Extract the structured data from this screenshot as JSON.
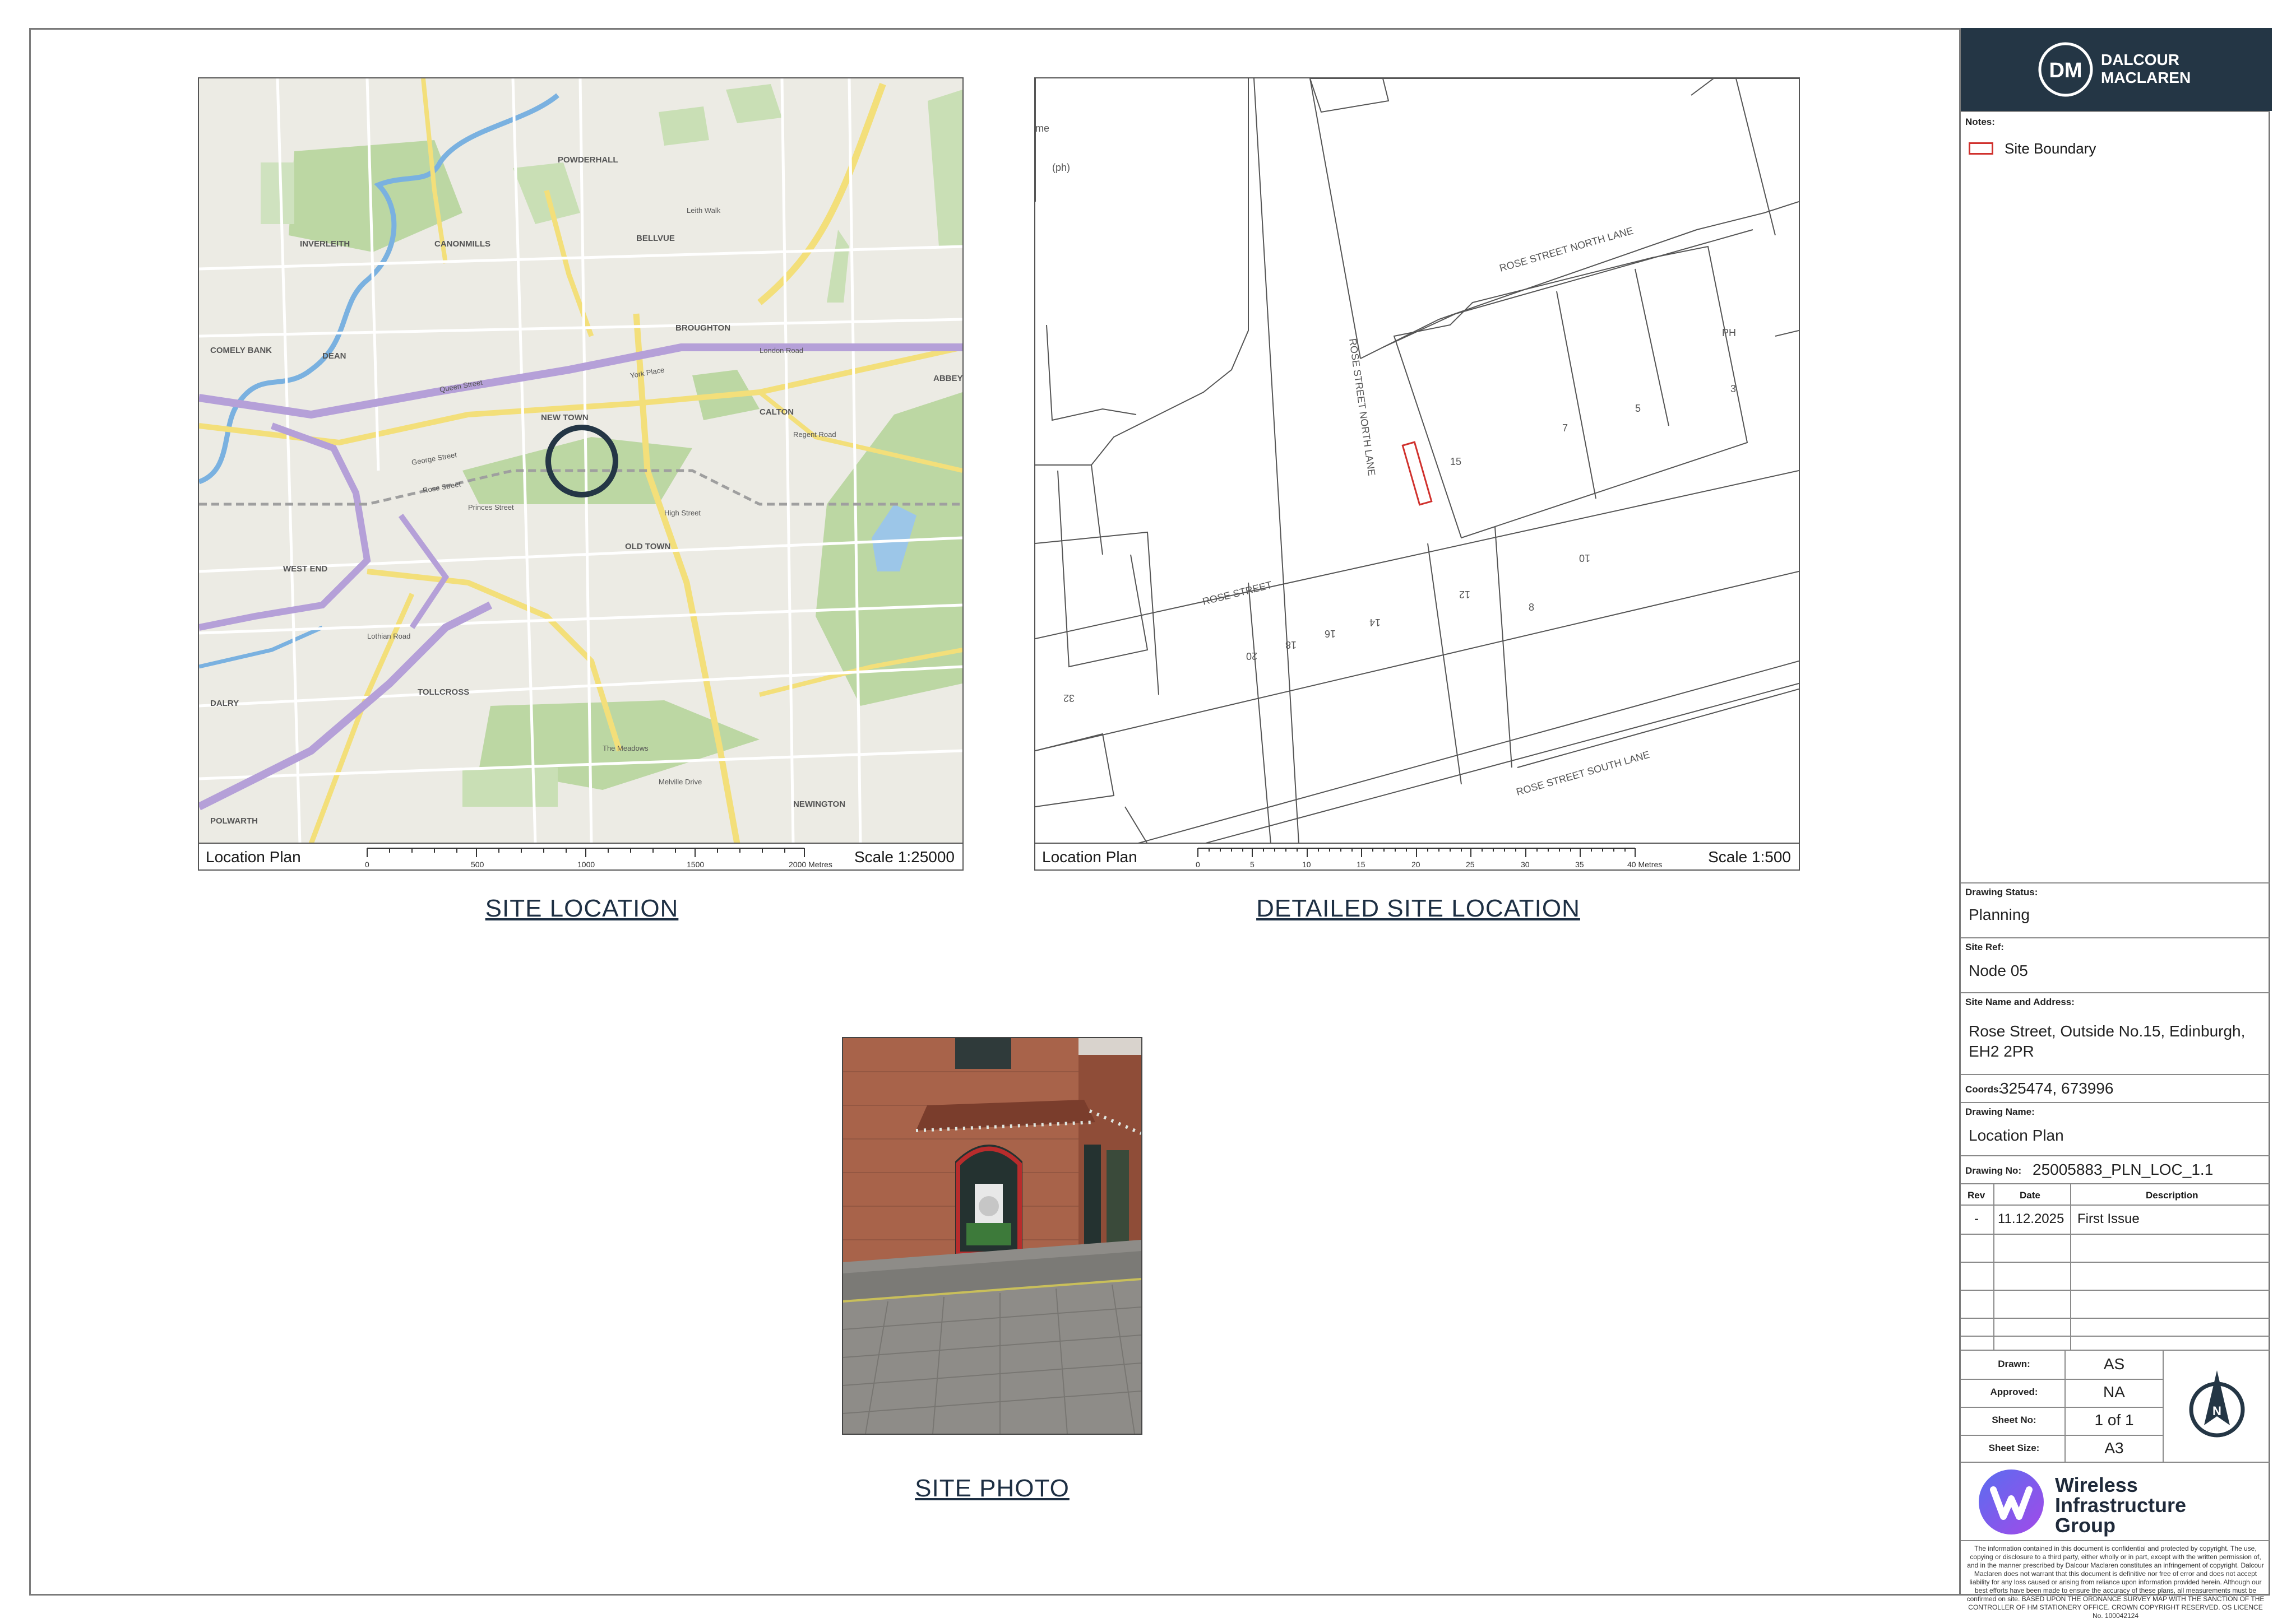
{
  "captions": {
    "site_location": "SITE LOCATION",
    "detailed_site_location": "DETAILED SITE LOCATION",
    "site_photo": "SITE PHOTO"
  },
  "map1": {
    "label": "Location Plan",
    "scale": "Scale 1:25000",
    "ticks": [
      "0",
      "500",
      "1000",
      "1500",
      "2000 Metres"
    ],
    "places": [
      "POWDERHALL",
      "INVERLEITH",
      "CANONMILLS",
      "BELLVUE",
      "BROUGHTON",
      "COMELY BANK",
      "DEAN",
      "NEW TOWN",
      "CALTON",
      "WEST END",
      "OLD TOWN",
      "TOLLCROSS",
      "DALRY",
      "POLWARTH",
      "NEWINGTON",
      "ABBEY"
    ],
    "streets": [
      "Queen Street",
      "York Place",
      "London Road",
      "Princes Street",
      "George Street",
      "Rose Street",
      "High Street",
      "The Meadows",
      "Melville Drive",
      "Lothian Road",
      "Leith Walk",
      "Regent Road"
    ]
  },
  "map2": {
    "label": "Location Plan",
    "scale": "Scale 1:500",
    "ticks": [
      "0",
      "5",
      "10",
      "15",
      "20",
      "25",
      "30",
      "35",
      "40 Metres"
    ],
    "street_labels": [
      "ROSE STREET NORTH LANE",
      "ROSE STREET NORTH LANE",
      "ROSE STREET",
      "ROSE STREET SOUTH LANE"
    ],
    "numbers": [
      "PH",
      "3",
      "5",
      "7",
      "15",
      "10",
      "12",
      "8",
      "14",
      "16",
      "18",
      "20",
      "32",
      "(ph)",
      "me"
    ]
  },
  "title_block": {
    "brand_line1": "DALCOUR",
    "brand_line2": "MACLAREN",
    "brand_mark": "DM",
    "notes_label": "Notes:",
    "legend_site_boundary": "Site Boundary",
    "drawing_status_label": "Drawing Status:",
    "drawing_status": "Planning",
    "site_ref_label": "Site Ref:",
    "site_ref": "Node 05",
    "site_name_label": "Site Name and Address:",
    "site_name_line1": "Rose Street, Outside No.15, Edinburgh,",
    "site_name_line2": "EH2 2PR",
    "coords_label": "Coords:",
    "coords": "325474, 673996",
    "drawing_name_label": "Drawing Name:",
    "drawing_name": "Location Plan",
    "drawing_no_label": "Drawing No:",
    "drawing_no": "25005883_PLN_LOC_1.1",
    "rev_header": {
      "rev": "Rev",
      "date": "Date",
      "description": "Description"
    },
    "revisions": [
      {
        "rev": "-",
        "date": "11.12.2025",
        "description": "First Issue"
      }
    ],
    "drawn_label": "Drawn:",
    "drawn": "AS",
    "approved_label": "Approved:",
    "approved": "NA",
    "sheet_no_label": "Sheet No:",
    "sheet_no": "1 of 1",
    "sheet_size_label": "Sheet Size:",
    "sheet_size": "A3",
    "north_letter": "N",
    "wig_line1": "Wireless",
    "wig_line2": "Infrastructure",
    "wig_line3": "Group",
    "disclaimer": "The information contained in this document is confidential and protected by copyright. The use, copying or disclosure to a third party, either wholly or in part, except with the written permission of, and in the manner prescribed by Dalcour Maclaren constitutes an infringement of copyright. Dalcour Maclaren does not warrant that this document is definitive nor free of error and does not accept liability for any loss caused or arising from reliance upon information provided herein. Although our best efforts have been made to ensure the accuracy of these plans, all measurements must be confirmed on site. BASED UPON THE ORDNANCE SURVEY MAP WITH THE SANCTION OF THE CONTROLLER OF HM STATIONERY OFFICE. CROWN COPYRIGHT RESERVED. OS LICENCE No. 100042124"
  },
  "colors": {
    "brand_navy": "#243645",
    "site_boundary_red": "#d0312d",
    "wig_purple": "#7a4cf0"
  }
}
